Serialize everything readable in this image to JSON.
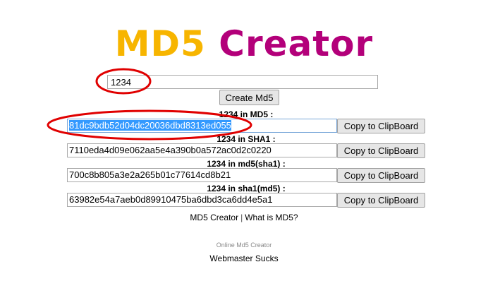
{
  "logo": {
    "word1": "MD5",
    "word2": "Creator",
    "colors": {
      "word1": "#f7b500",
      "word2": "#b3007a"
    }
  },
  "input": {
    "value": "1234"
  },
  "create_button": "Create Md5",
  "sections": [
    {
      "label": "1234 in MD5 :",
      "value": "81dc9bdb52d04dc20036dbd8313ed055",
      "button": "Copy to ClipBoard"
    },
    {
      "label": "1234 in SHA1 :",
      "value": "7110eda4d09e062aa5e4a390b0a572ac0d2c0220",
      "button": "Copy to ClipBoard"
    },
    {
      "label": "1234 in md5(sha1) :",
      "value": "700c8b805a3e2a265b01c77614cd8b21",
      "button": "Copy to ClipBoard"
    },
    {
      "label": "1234 in sha1(md5) :",
      "value": "63982e54a7aeb0d89910475ba6dbd3ca6dd4e5a1",
      "button": "Copy to ClipBoard"
    }
  ],
  "footer": {
    "link1": "MD5 Creator",
    "separator": "|",
    "link2": "What is MD5?"
  },
  "small_text": "Online Md5 Creator",
  "webmaster": "Webmaster Sucks",
  "annotation_color": "#e00000",
  "selection_color": "#3399ff"
}
